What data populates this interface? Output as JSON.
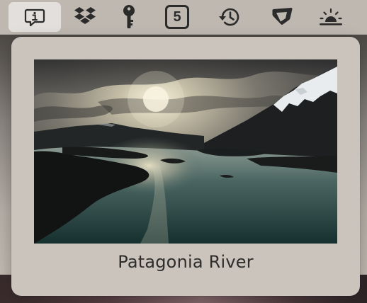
{
  "menubar": {
    "items": [
      {
        "icon": "info-message-icon",
        "active": true
      },
      {
        "icon": "dropbox-icon",
        "active": false
      },
      {
        "icon": "key-icon",
        "active": false
      },
      {
        "icon": "calendar-date-icon",
        "label": "5",
        "active": false
      },
      {
        "icon": "time-machine-icon",
        "active": false
      },
      {
        "icon": "flag-icon",
        "active": false
      },
      {
        "icon": "sunrise-icon",
        "active": false
      }
    ]
  },
  "popover": {
    "image_name": "landscape-photo",
    "caption": "Patagonia River"
  },
  "colors": {
    "menubar_bg": "#bfb8b1",
    "popover_bg": "#cac4bd",
    "active_highlight": "#e6e2de",
    "icon": "#2b2b2b"
  }
}
